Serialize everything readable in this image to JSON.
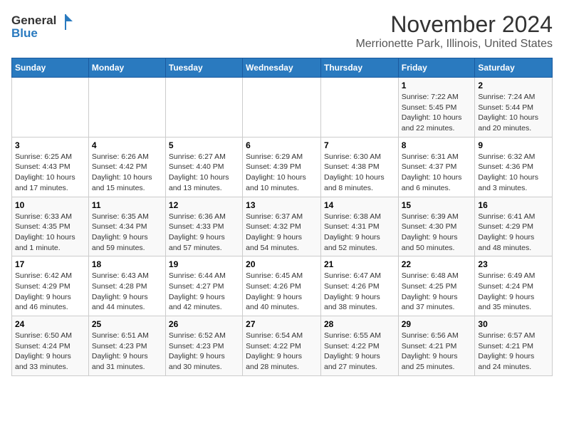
{
  "header": {
    "logo_general": "General",
    "logo_blue": "Blue",
    "title": "November 2024",
    "subtitle": "Merrionette Park, Illinois, United States"
  },
  "calendar": {
    "days_of_week": [
      "Sunday",
      "Monday",
      "Tuesday",
      "Wednesday",
      "Thursday",
      "Friday",
      "Saturday"
    ],
    "weeks": [
      [
        {
          "day": "",
          "info": ""
        },
        {
          "day": "",
          "info": ""
        },
        {
          "day": "",
          "info": ""
        },
        {
          "day": "",
          "info": ""
        },
        {
          "day": "",
          "info": ""
        },
        {
          "day": "1",
          "info": "Sunrise: 7:22 AM\nSunset: 5:45 PM\nDaylight: 10 hours\nand 22 minutes."
        },
        {
          "day": "2",
          "info": "Sunrise: 7:24 AM\nSunset: 5:44 PM\nDaylight: 10 hours\nand 20 minutes."
        }
      ],
      [
        {
          "day": "3",
          "info": "Sunrise: 6:25 AM\nSunset: 4:43 PM\nDaylight: 10 hours\nand 17 minutes."
        },
        {
          "day": "4",
          "info": "Sunrise: 6:26 AM\nSunset: 4:42 PM\nDaylight: 10 hours\nand 15 minutes."
        },
        {
          "day": "5",
          "info": "Sunrise: 6:27 AM\nSunset: 4:40 PM\nDaylight: 10 hours\nand 13 minutes."
        },
        {
          "day": "6",
          "info": "Sunrise: 6:29 AM\nSunset: 4:39 PM\nDaylight: 10 hours\nand 10 minutes."
        },
        {
          "day": "7",
          "info": "Sunrise: 6:30 AM\nSunset: 4:38 PM\nDaylight: 10 hours\nand 8 minutes."
        },
        {
          "day": "8",
          "info": "Sunrise: 6:31 AM\nSunset: 4:37 PM\nDaylight: 10 hours\nand 6 minutes."
        },
        {
          "day": "9",
          "info": "Sunrise: 6:32 AM\nSunset: 4:36 PM\nDaylight: 10 hours\nand 3 minutes."
        }
      ],
      [
        {
          "day": "10",
          "info": "Sunrise: 6:33 AM\nSunset: 4:35 PM\nDaylight: 10 hours\nand 1 minute."
        },
        {
          "day": "11",
          "info": "Sunrise: 6:35 AM\nSunset: 4:34 PM\nDaylight: 9 hours\nand 59 minutes."
        },
        {
          "day": "12",
          "info": "Sunrise: 6:36 AM\nSunset: 4:33 PM\nDaylight: 9 hours\nand 57 minutes."
        },
        {
          "day": "13",
          "info": "Sunrise: 6:37 AM\nSunset: 4:32 PM\nDaylight: 9 hours\nand 54 minutes."
        },
        {
          "day": "14",
          "info": "Sunrise: 6:38 AM\nSunset: 4:31 PM\nDaylight: 9 hours\nand 52 minutes."
        },
        {
          "day": "15",
          "info": "Sunrise: 6:39 AM\nSunset: 4:30 PM\nDaylight: 9 hours\nand 50 minutes."
        },
        {
          "day": "16",
          "info": "Sunrise: 6:41 AM\nSunset: 4:29 PM\nDaylight: 9 hours\nand 48 minutes."
        }
      ],
      [
        {
          "day": "17",
          "info": "Sunrise: 6:42 AM\nSunset: 4:29 PM\nDaylight: 9 hours\nand 46 minutes."
        },
        {
          "day": "18",
          "info": "Sunrise: 6:43 AM\nSunset: 4:28 PM\nDaylight: 9 hours\nand 44 minutes."
        },
        {
          "day": "19",
          "info": "Sunrise: 6:44 AM\nSunset: 4:27 PM\nDaylight: 9 hours\nand 42 minutes."
        },
        {
          "day": "20",
          "info": "Sunrise: 6:45 AM\nSunset: 4:26 PM\nDaylight: 9 hours\nand 40 minutes."
        },
        {
          "day": "21",
          "info": "Sunrise: 6:47 AM\nSunset: 4:26 PM\nDaylight: 9 hours\nand 38 minutes."
        },
        {
          "day": "22",
          "info": "Sunrise: 6:48 AM\nSunset: 4:25 PM\nDaylight: 9 hours\nand 37 minutes."
        },
        {
          "day": "23",
          "info": "Sunrise: 6:49 AM\nSunset: 4:24 PM\nDaylight: 9 hours\nand 35 minutes."
        }
      ],
      [
        {
          "day": "24",
          "info": "Sunrise: 6:50 AM\nSunset: 4:24 PM\nDaylight: 9 hours\nand 33 minutes."
        },
        {
          "day": "25",
          "info": "Sunrise: 6:51 AM\nSunset: 4:23 PM\nDaylight: 9 hours\nand 31 minutes."
        },
        {
          "day": "26",
          "info": "Sunrise: 6:52 AM\nSunset: 4:23 PM\nDaylight: 9 hours\nand 30 minutes."
        },
        {
          "day": "27",
          "info": "Sunrise: 6:54 AM\nSunset: 4:22 PM\nDaylight: 9 hours\nand 28 minutes."
        },
        {
          "day": "28",
          "info": "Sunrise: 6:55 AM\nSunset: 4:22 PM\nDaylight: 9 hours\nand 27 minutes."
        },
        {
          "day": "29",
          "info": "Sunrise: 6:56 AM\nSunset: 4:21 PM\nDaylight: 9 hours\nand 25 minutes."
        },
        {
          "day": "30",
          "info": "Sunrise: 6:57 AM\nSunset: 4:21 PM\nDaylight: 9 hours\nand 24 minutes."
        }
      ]
    ]
  }
}
